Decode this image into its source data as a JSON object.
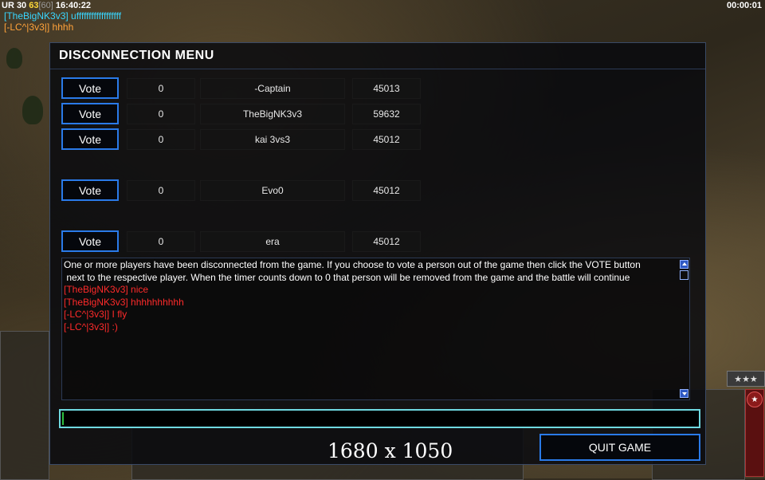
{
  "hud": {
    "stats": {
      "ur": "UR 30",
      "fps": "63",
      "max_fps": "[60]",
      "clock": "16:40:22"
    },
    "game_timer": "00:00:01",
    "chat": [
      {
        "text": "[TheBigNK3v3] uffffffffffffffffff"
      },
      {
        "text": "[-LC^|3v3|] hhhh"
      }
    ]
  },
  "dialog": {
    "title": "DISCONNECTION MENU",
    "vote_label": "Vote",
    "players": [
      {
        "count": "0",
        "name": "-Captain",
        "id": "45013"
      },
      {
        "count": "0",
        "name": "TheBigNK3v3",
        "id": "59632"
      },
      {
        "count": "0",
        "name": "kai 3vs3",
        "id": "45012"
      },
      {
        "count": "0",
        "name": "Evo0",
        "id": "45012"
      },
      {
        "count": "0",
        "name": "era",
        "id": "45012"
      }
    ],
    "messages": {
      "info_line1": "One or more players have been disconnected from the game. If you choose to vote a person out of the game then click the VOTE button",
      "info_line2": " next to the respective player. When the timer counts down to 0 that person will be removed from the game and the battle will continue",
      "chat": [
        "[TheBigNK3v3] nice",
        "[TheBigNK3v3] hhhhhhhhhh",
        "[-LC^|3v3|] I fly",
        "[-LC^|3v3|] :)"
      ]
    },
    "chat_input_value": "",
    "resolution_label": "1680 x 1050",
    "quit_label": "QUIT GAME"
  },
  "side": {
    "stars_label": "★★★",
    "general_icon": "star-icon"
  },
  "colors": {
    "vote_border": "#2a7ae8",
    "chat_red": "#ff2a2a",
    "chat_cyan": "#38d6ff",
    "chat_orange": "#ffa23a",
    "input_border": "#6fd8e0"
  }
}
